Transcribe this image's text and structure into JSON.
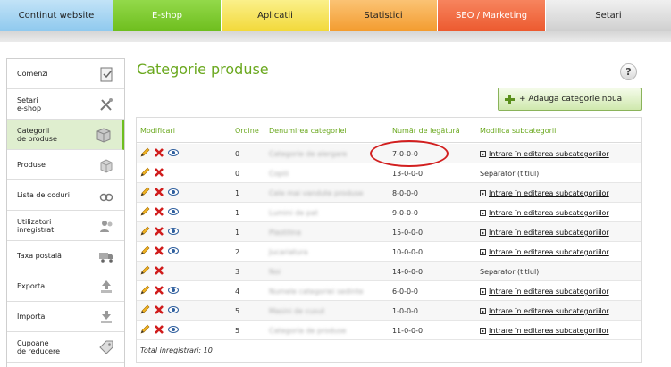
{
  "top_nav": {
    "tabs": [
      {
        "label": "Continut website"
      },
      {
        "label": "E-shop"
      },
      {
        "label": "Aplicatii"
      },
      {
        "label": "Statistici"
      },
      {
        "label": "SEO / Marketing"
      },
      {
        "label": "Setari"
      }
    ],
    "active": "E-shop"
  },
  "sidebar": {
    "items": [
      {
        "label": "Comenzi",
        "icon": "clipboard-icon"
      },
      {
        "label": "Setari\ne-shop",
        "icon": "tools-icon"
      },
      {
        "label": "Categorii\nde produse",
        "icon": "box-icon",
        "active": true
      },
      {
        "label": "Produse",
        "icon": "boxes-icon"
      },
      {
        "label": "Lista de coduri",
        "icon": "link-icon"
      },
      {
        "label": "Utilizatori\ninregistrati",
        "icon": "users-icon"
      },
      {
        "label": "Taxa poștală",
        "icon": "truck-icon"
      },
      {
        "label": "Exporta",
        "icon": "upload-icon"
      },
      {
        "label": "Importa",
        "icon": "download-icon"
      },
      {
        "label": "Cupoane\nde reducere",
        "icon": "tag-icon"
      }
    ]
  },
  "page": {
    "title": "Categorie produse",
    "help_label": "?",
    "add_button_label": "+ Adauga categorie noua"
  },
  "table": {
    "headers": {
      "modificari": "Modificari",
      "ordine": "Ordine",
      "denumire": "Denumirea categoriei",
      "numar": "Număr de legătură",
      "subcategorii": "Modifica subcategorii"
    },
    "rows": [
      {
        "ordine": "0",
        "denumire": "Categorie de alergare",
        "numar": "7-0-0-0",
        "sub": "Intrare în editarea subcategoriilor",
        "has_view": true,
        "is_link": true
      },
      {
        "ordine": "0",
        "denumire": "Copiii",
        "numar": "13-0-0-0",
        "sub": "Separator (titlul)",
        "has_view": false,
        "is_link": false
      },
      {
        "ordine": "1",
        "denumire": "Cele mai vandute produse",
        "numar": "8-0-0-0",
        "sub": "Intrare în editarea subcategoriilor",
        "has_view": true,
        "is_link": true
      },
      {
        "ordine": "1",
        "denumire": "Lumini de pat",
        "numar": "9-0-0-0",
        "sub": "Intrare în editarea subcategoriilor",
        "has_view": true,
        "is_link": true
      },
      {
        "ordine": "1",
        "denumire": "Plastilina",
        "numar": "15-0-0-0",
        "sub": "Intrare în editarea subcategoriilor",
        "has_view": true,
        "is_link": true
      },
      {
        "ordine": "2",
        "denumire": "Jucariatura",
        "numar": "10-0-0-0",
        "sub": "Intrare în editarea subcategoriilor",
        "has_view": true,
        "is_link": true
      },
      {
        "ordine": "3",
        "denumire": "Noi",
        "numar": "14-0-0-0",
        "sub": "Separator (titlul)",
        "has_view": false,
        "is_link": false
      },
      {
        "ordine": "4",
        "denumire": "Numele categoriei sedinte",
        "numar": "6-0-0-0",
        "sub": "Intrare în editarea subcategoriilor",
        "has_view": true,
        "is_link": true
      },
      {
        "ordine": "5",
        "denumire": "Masini de cusut",
        "numar": "1-0-0-0",
        "sub": "Intrare în editarea subcategoriilor",
        "has_view": true,
        "is_link": true
      },
      {
        "ordine": "5",
        "denumire": "Categoria de produse",
        "numar": "11-0-0-0",
        "sub": "Intrare în editarea subcategoriilor",
        "has_view": true,
        "is_link": true
      }
    ],
    "total_label": "Total inregistrari: 10"
  },
  "colors": {
    "accent": "#6aa81e",
    "highlight_circle": "#d21f1f"
  }
}
